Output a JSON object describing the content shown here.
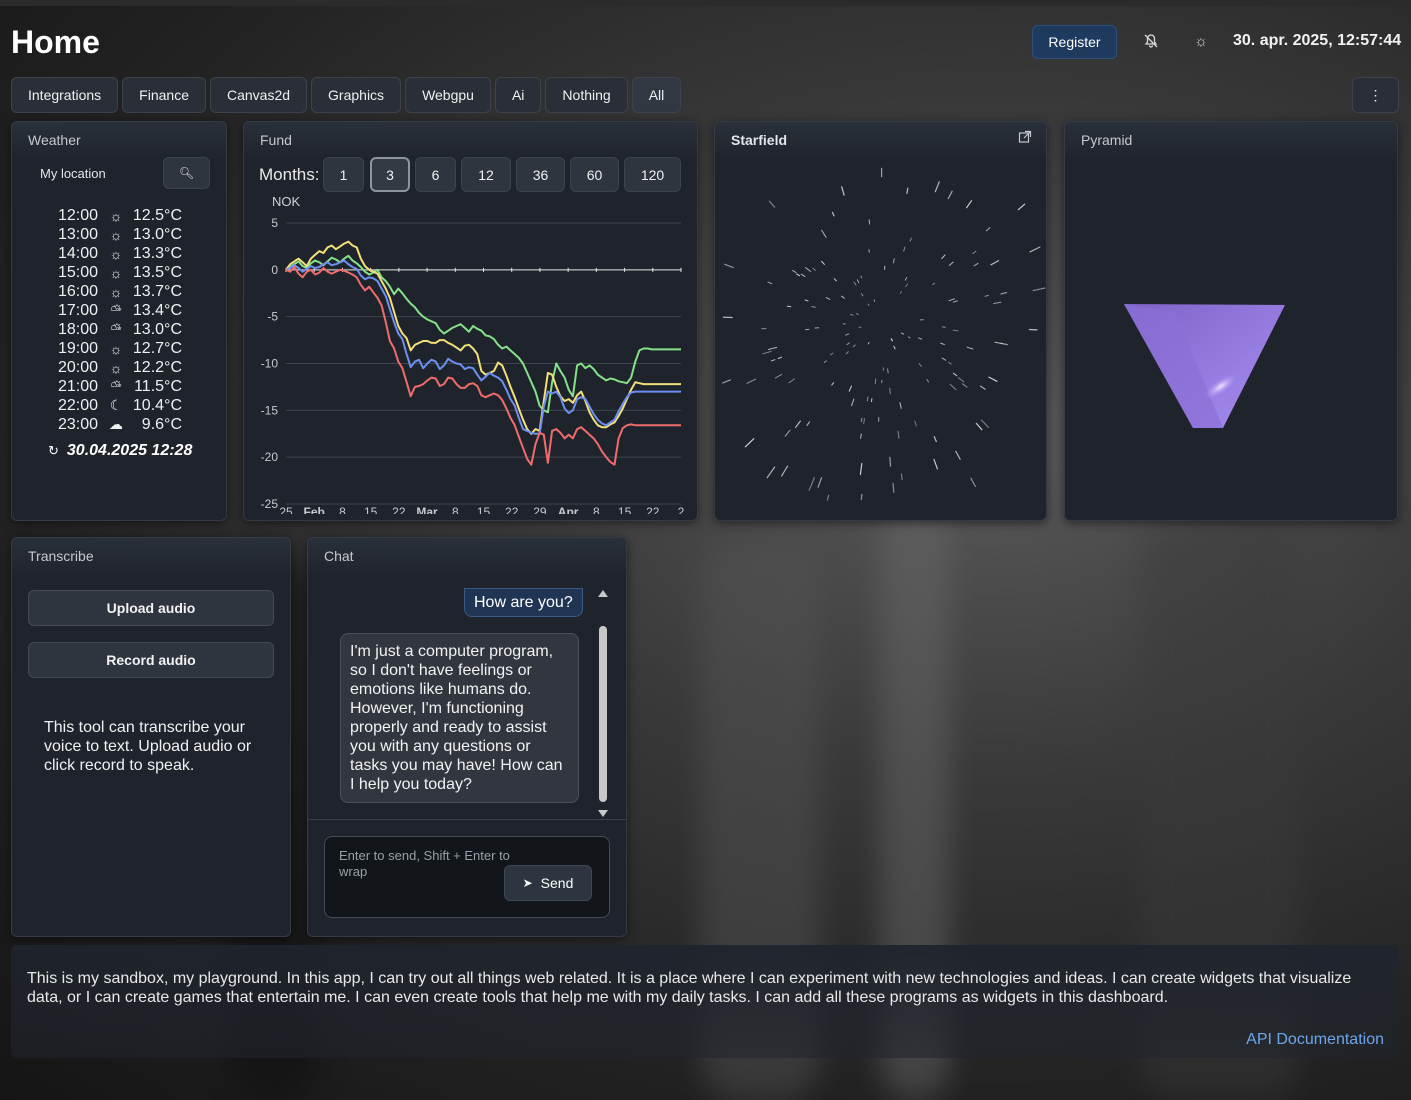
{
  "header": {
    "title": "Home",
    "register_label": "Register",
    "datetime": "30. apr. 2025, 12:57:44",
    "icons": [
      "notifications-off-icon",
      "theme-sun-icon"
    ]
  },
  "tabs": [
    "Integrations",
    "Finance",
    "Canvas2d",
    "Graphics",
    "Webgpu",
    "Ai",
    "Nothing",
    "All"
  ],
  "active_tab": "All",
  "weather": {
    "title": "Weather",
    "location_label": "My location",
    "rows": [
      {
        "time": "12:00",
        "icon": "sun",
        "temp": "12.5°C"
      },
      {
        "time": "13:00",
        "icon": "sun",
        "temp": "13.0°C"
      },
      {
        "time": "14:00",
        "icon": "sun",
        "temp": "13.3°C"
      },
      {
        "time": "15:00",
        "icon": "sun",
        "temp": "13.5°C"
      },
      {
        "time": "16:00",
        "icon": "sun",
        "temp": "13.7°C"
      },
      {
        "time": "17:00",
        "icon": "partly-cloudy",
        "temp": "13.4°C"
      },
      {
        "time": "18:00",
        "icon": "partly-cloudy",
        "temp": "13.0°C"
      },
      {
        "time": "19:00",
        "icon": "sun",
        "temp": "12.7°C"
      },
      {
        "time": "20:00",
        "icon": "sun",
        "temp": "12.2°C"
      },
      {
        "time": "21:00",
        "icon": "partly-cloudy",
        "temp": "11.5°C"
      },
      {
        "time": "22:00",
        "icon": "moon",
        "temp": "10.4°C"
      },
      {
        "time": "23:00",
        "icon": "cloudy-night",
        "temp": "9.6°C"
      }
    ],
    "updated": "30.04.2025 12:28"
  },
  "fund": {
    "title": "Fund",
    "months_label": "Months:",
    "month_options": [
      "1",
      "3",
      "6",
      "12",
      "36",
      "60",
      "120"
    ],
    "selected_months": "3",
    "unit_label": "NOK"
  },
  "chart_data": {
    "type": "line",
    "ylabel": "NOK",
    "ylim": [
      -25,
      5
    ],
    "yticks": [
      5,
      0,
      -5,
      -10,
      -15,
      -20,
      -25
    ],
    "x_ticks": [
      "25",
      "Feb",
      "8",
      "15",
      "22",
      "Mar",
      "8",
      "15",
      "22",
      "29",
      "Apr",
      "8",
      "15",
      "22",
      "2"
    ],
    "x": [
      0,
      1,
      2,
      3,
      4,
      5,
      6,
      7,
      8,
      9,
      10,
      11,
      12,
      13,
      14,
      15,
      16,
      17,
      18,
      19,
      20,
      21,
      22,
      23,
      24,
      25,
      26,
      27,
      28,
      29,
      30,
      31,
      32,
      33,
      34,
      35,
      36,
      37,
      38,
      39,
      40,
      41,
      42,
      43,
      44,
      45,
      46,
      47,
      48,
      49,
      50,
      51,
      52,
      53,
      54,
      55,
      56,
      57,
      58,
      59,
      60,
      61,
      62,
      63,
      64,
      65,
      66,
      67,
      68,
      69,
      70,
      71,
      72,
      73,
      74,
      75,
      76,
      77,
      78,
      79,
      80,
      81,
      82,
      83,
      84,
      85,
      86,
      87,
      88,
      89,
      90,
      91,
      92,
      93,
      94,
      95
    ],
    "series": [
      {
        "color": "#86e08a",
        "values": [
          0,
          0.3,
          0.6,
          0.9,
          0.4,
          0.2,
          0.7,
          1.0,
          0.8,
          0.5,
          0.9,
          1.3,
          1.1,
          0.8,
          1.2,
          1.5,
          1.0,
          0.7,
          0.3,
          -0.2,
          -0.5,
          -0.3,
          0,
          -0.8,
          -1.2,
          -1.8,
          -2.6,
          -2.0,
          -2.5,
          -3.1,
          -3.6,
          -4.0,
          -4.6,
          -5.0,
          -5.3,
          -5.5,
          -5.7,
          -6.4,
          -6.8,
          -6.5,
          -6.2,
          -6.0,
          -5.8,
          -6.2,
          -6.6,
          -6.0,
          -6.3,
          -6.5,
          -7.0,
          -7.1,
          -7.4,
          -8.0,
          -8.4,
          -8.2,
          -8.6,
          -9.0,
          -9.4,
          -10.0,
          -11.0,
          -12.0,
          -13.0,
          -14.5,
          -15.0,
          -15.2,
          -12.0,
          -10.0,
          -10.8,
          -11.5,
          -12.8,
          -13.5,
          -10.2,
          -10.0,
          -10.5,
          -10.2,
          -10.6,
          -11.2,
          -11.5,
          -11.8,
          -11.6,
          -11.7,
          -11.9,
          -12.0,
          -12.1,
          -11.5,
          -9.8,
          -8.6,
          -8.4,
          -8.4,
          -8.5,
          -8.5,
          -8.5,
          -8.5,
          -8.5,
          -8.5,
          -8.5,
          -8.5
        ]
      },
      {
        "color": "#f1e07a",
        "values": [
          0,
          0.6,
          0.9,
          1.2,
          0.8,
          0.4,
          1.2,
          1.6,
          2.0,
          1.8,
          2.4,
          2.6,
          2.2,
          2.5,
          2.8,
          3.0,
          2.6,
          2.4,
          1.2,
          0.4,
          0,
          -0.2,
          -0.4,
          -1.2,
          -2.0,
          -3.0,
          -4.5,
          -6.0,
          -6.8,
          -7.3,
          -8.6,
          -8.0,
          -7.8,
          -7.6,
          -7.6,
          -7.8,
          -7.8,
          -7.5,
          -7.5,
          -7.8,
          -8.0,
          -8.3,
          -8.6,
          -8.1,
          -8.0,
          -8.4,
          -9.0,
          -10.8,
          -11.2,
          -11.0,
          -10.8,
          -9.9,
          -10.2,
          -11.3,
          -12.5,
          -13.6,
          -14.8,
          -16.0,
          -17.0,
          -17.5,
          -17.0,
          -17.2,
          -14.0,
          -11.0,
          -11.2,
          -12.5,
          -13.5,
          -14.0,
          -13.8,
          -14.2,
          -13.4,
          -13.0,
          -14.0,
          -15.2,
          -16.0,
          -16.6,
          -16.8,
          -16.8,
          -16.5,
          -16.3,
          -15.6,
          -14.8,
          -13.8,
          -12.8,
          -12.0,
          -12.1,
          -12.2,
          -12.2,
          -12.2,
          -12.2,
          -12.2,
          -12.2,
          -12.2,
          -12.2,
          -12.2,
          -12.2
        ]
      },
      {
        "color": "#6d8ff0",
        "values": [
          0,
          0.2,
          0.5,
          0.2,
          -0.2,
          0.1,
          0.4,
          0.2,
          0.3,
          0.6,
          0.8,
          0.5,
          0.6,
          0.8,
          1.0,
          0.6,
          0.3,
          0.1,
          -0.6,
          -1.0,
          -0.8,
          -0.9,
          -1.2,
          -2.0,
          -2.8,
          -4.2,
          -5.6,
          -6.8,
          -7.4,
          -9.0,
          -10.4,
          -9.8,
          -9.6,
          -10.5,
          -10.0,
          -9.6,
          -9.8,
          -10.6,
          -10.2,
          -9.5,
          -9.8,
          -10.0,
          -10.1,
          -10.6,
          -10.4,
          -10.5,
          -11.2,
          -11.8,
          -11.4,
          -11.0,
          -11.3,
          -11.5,
          -11.9,
          -12.8,
          -13.8,
          -14.5,
          -15.8,
          -17.0,
          -17.2,
          -17.4,
          -17.5,
          -17.5,
          -14.6,
          -13.0,
          -13.2,
          -13.0,
          -13.6,
          -14.8,
          -15.3,
          -15.0,
          -13.8,
          -13.6,
          -13.8,
          -14.6,
          -15.4,
          -16.0,
          -16.4,
          -16.6,
          -16.3,
          -16.0,
          -15.1,
          -14.3,
          -13.6,
          -13.1,
          -13.0,
          -13.0,
          -13.0,
          -13.0,
          -13.0,
          -13.0,
          -13.0,
          -13.0,
          -13.0,
          -13.0,
          -13.0,
          -13.0
        ]
      },
      {
        "color": "#f06b6b",
        "values": [
          0,
          -0.2,
          0.3,
          -0.4,
          -0.8,
          -0.2,
          0.0,
          -0.5,
          -0.3,
          0.2,
          -0.2,
          -0.4,
          -0.2,
          0,
          -0.1,
          -0.3,
          -0.5,
          -0.8,
          -1.6,
          -2.2,
          -1.8,
          -2.4,
          -3.0,
          -3.8,
          -5.6,
          -7.6,
          -8.4,
          -9.8,
          -10.5,
          -12.0,
          -13.5,
          -12.5,
          -12.4,
          -12.2,
          -11.8,
          -11.5,
          -11.6,
          -12.4,
          -12.2,
          -11.5,
          -11.6,
          -12.2,
          -12.6,
          -12.6,
          -12.2,
          -12.1,
          -12.4,
          -13.4,
          -13.6,
          -13.4,
          -13.2,
          -13.4,
          -13.9,
          -14.8,
          -15.8,
          -16.6,
          -17.8,
          -19.0,
          -20.2,
          -20.8,
          -18.6,
          -17.4,
          -17.6,
          -20.6,
          -17.2,
          -17.0,
          -17.4,
          -18.0,
          -17.6,
          -18.0,
          -17.0,
          -16.8,
          -17.2,
          -17.6,
          -18.0,
          -18.6,
          -19.4,
          -20.0,
          -20.5,
          -20.8,
          -18.0,
          -16.9,
          -16.6,
          -16.5,
          -16.6,
          -16.6,
          -16.6,
          -16.6,
          -16.6,
          -16.6,
          -16.6,
          -16.6,
          -16.6,
          -16.6,
          -16.6,
          -16.6
        ]
      }
    ],
    "grid": true
  },
  "starfield": {
    "title": "Starfield",
    "icon": "external-link-icon"
  },
  "pyramid": {
    "title": "Pyramid"
  },
  "transcribe": {
    "title": "Transcribe",
    "upload_label": "Upload audio",
    "record_label": "Record audio",
    "description": "This tool can transcribe your voice to text. Upload audio or click record to speak."
  },
  "chat": {
    "title": "Chat",
    "user_message": "How are you?",
    "bot_message": "I'm just a computer program, so I don't have feelings or emotions like humans do. However, I'm functioning properly and ready to assist you with any questions or tasks you may have! How can I help you today?",
    "input_placeholder": "Enter to send, Shift + Enter to wrap",
    "send_label": "Send"
  },
  "footer": {
    "text": "This is my sandbox, my playground. In this app, I can try out all things web related. It is a place where I can experiment with new technologies and ideas. I can create widgets that visualize data, or I can create games that entertain me. I can even create tools that help me with my daily tasks. I can add all these programs as widgets in this dashboard.",
    "api_link": "API Documentation"
  },
  "colors": {
    "accent": "#1e3a5f",
    "card": "#1f242c",
    "link": "#6ea5ea",
    "pyramid": "#a98ef2"
  }
}
